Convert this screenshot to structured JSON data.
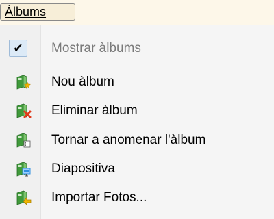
{
  "menubar": {
    "title": "Àlbums"
  },
  "menu": {
    "items": [
      {
        "label": "Mostrar àlbums",
        "checked": true,
        "enabled": false,
        "icon": "checkmark-icon"
      },
      {
        "label": "Nou àlbum",
        "enabled": true,
        "icon": "new-album-icon"
      },
      {
        "label": "Eliminar àlbum",
        "enabled": true,
        "icon": "delete-album-icon"
      },
      {
        "label": "Tornar a anomenar l'àlbum",
        "enabled": true,
        "icon": "rename-album-icon"
      },
      {
        "label": "Diapositiva",
        "enabled": true,
        "icon": "slideshow-icon"
      },
      {
        "label": "Importar Fotos...",
        "enabled": true,
        "icon": "import-photos-icon"
      }
    ]
  },
  "colors": {
    "book_green": "#3f9a3a",
    "delete_red": "#e03a1a",
    "new_star": "#f0b400",
    "import_arrow": "#f2b600",
    "slideshow_blue": "#2f8fe0",
    "disabled_text": "#7a7a7a"
  }
}
